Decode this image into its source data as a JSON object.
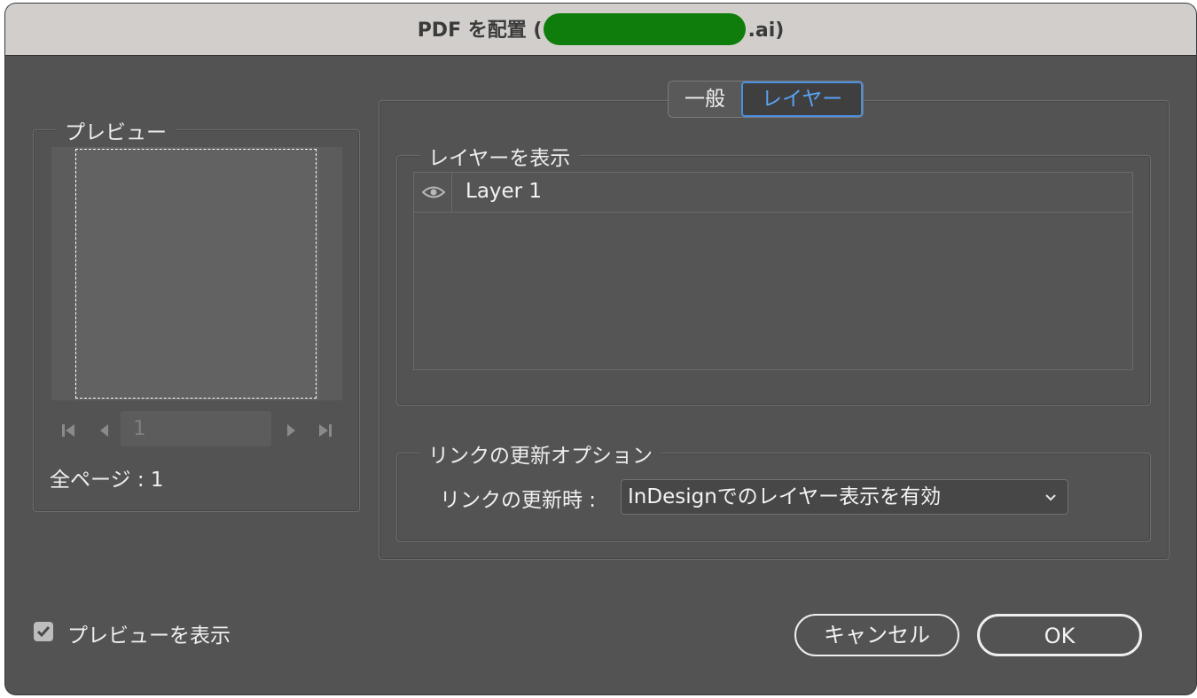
{
  "window": {
    "title_prefix": "PDF を配置 (",
    "title_suffix": ".ai)"
  },
  "tabs": [
    {
      "label": "一般",
      "active": false
    },
    {
      "label": "レイヤー",
      "active": true
    }
  ],
  "preview": {
    "legend": "プレビュー",
    "page_field": "1",
    "total_pages": "全ページ : 1"
  },
  "layers": {
    "legend": "レイヤーを表示",
    "rows": [
      {
        "name": "Layer 1",
        "visible": true
      }
    ]
  },
  "link_update": {
    "legend": "リンクの更新オプション",
    "label": "リンクの更新時 :",
    "selected": "InDesignでのレイヤー表示を有効"
  },
  "footer": {
    "show_preview_label": "プレビューを表示",
    "show_preview_checked": true,
    "cancel_label": "キャンセル",
    "ok_label": "OK"
  },
  "colors": {
    "dialog_bg": "#535353",
    "titlebar_bg": "#d1cecb",
    "active_tab_text": "#5aa2f3",
    "redaction": "#0f7d0b"
  }
}
